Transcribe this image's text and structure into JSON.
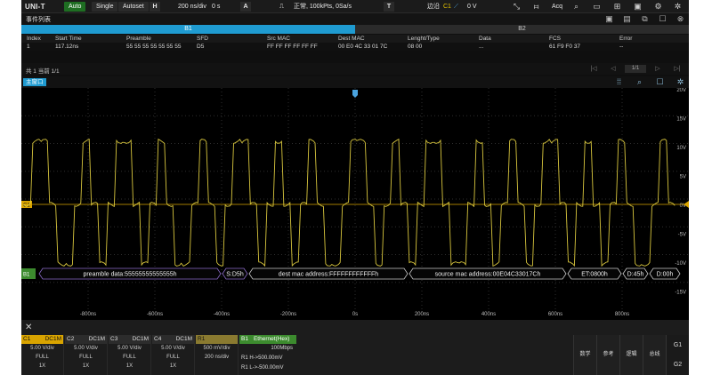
{
  "toolbar": {
    "logo": "UNI-T",
    "auto": "Auto",
    "single": "Single",
    "autoset": "Autoset",
    "h_letter": "H",
    "timebase": "200 ns/div",
    "time_offset": "0 s",
    "a_letter": "A",
    "acq_status": "正常, 100kPts, 0Sa/s",
    "t_letter": "T",
    "trigger_type": "边沿",
    "trigger_source": "C1",
    "trigger_level": "0 V",
    "acq_label": "Acq"
  },
  "event_list": {
    "title": "事件列表",
    "bus_tabs": [
      "B1",
      "B2"
    ],
    "columns": [
      "Index",
      "Start Time",
      "Preamble",
      "SFD",
      "Src MAC",
      "Dest MAC",
      "Lenght/Type",
      "Data",
      "FCS",
      "Error"
    ],
    "rows": [
      [
        "1",
        "117.12ns",
        "55 55 55 55 55 55 55",
        "D5",
        "FF FF FF FF FF FF",
        "00 E0 4C 33 01 7C",
        "08 00",
        "...",
        "61 F9 F0 37",
        "--"
      ]
    ],
    "pager_info": "共 1 当前 1/1",
    "page": "1/1"
  },
  "main_window": {
    "tab": "主窗口"
  },
  "scope": {
    "y_labels": [
      "20V",
      "15V",
      "10V",
      "5V",
      "0V",
      "-5V",
      "-10V",
      "-15V"
    ],
    "x_labels": [
      "-800ns",
      "-600ns",
      "-400ns",
      "-200ns",
      "0s",
      "200ns",
      "400ns",
      "600ns",
      "800ns"
    ],
    "ch_marker": "C1",
    "bus_marker": "B1",
    "decode": [
      "preamble data:55555555555555h",
      "S:D5h",
      "dest mac address:FFFFFFFFFFFFh",
      "source mac address:00E04C33017Ch",
      "ET:0800h",
      "D:45h",
      "D:00h"
    ],
    "trace_color": "#e3d040",
    "trigger_line_color": "#d9a400"
  },
  "channels": [
    {
      "name": "C1",
      "coupling": "DC1M",
      "scale": "5.00 V/div",
      "bw": "FULL",
      "probe": "1X"
    },
    {
      "name": "C2",
      "coupling": "DC1M",
      "scale": "5.00 V/div",
      "bw": "FULL",
      "probe": "1X"
    },
    {
      "name": "C3",
      "coupling": "DC1M",
      "scale": "5.00 V/div",
      "bw": "FULL",
      "probe": "1X"
    },
    {
      "name": "C4",
      "coupling": "DC1M",
      "scale": "5.00 V/div",
      "bw": "FULL",
      "probe": "1X"
    },
    {
      "name": "R1",
      "coupling": "",
      "scale": "500 mV/div",
      "bw": "200 ns/div",
      "probe": ""
    }
  ],
  "bus_panel": {
    "name": "B1",
    "protocol": "Ethernet(Hex)",
    "rate": "100Mbps",
    "h_threshold": "R1  H->500.00mV",
    "l_threshold": "R1  L->-500.00mV"
  },
  "side_buttons": [
    "数学",
    "参考",
    "逻辑",
    "总线"
  ],
  "groups": [
    "G1",
    "G2"
  ]
}
